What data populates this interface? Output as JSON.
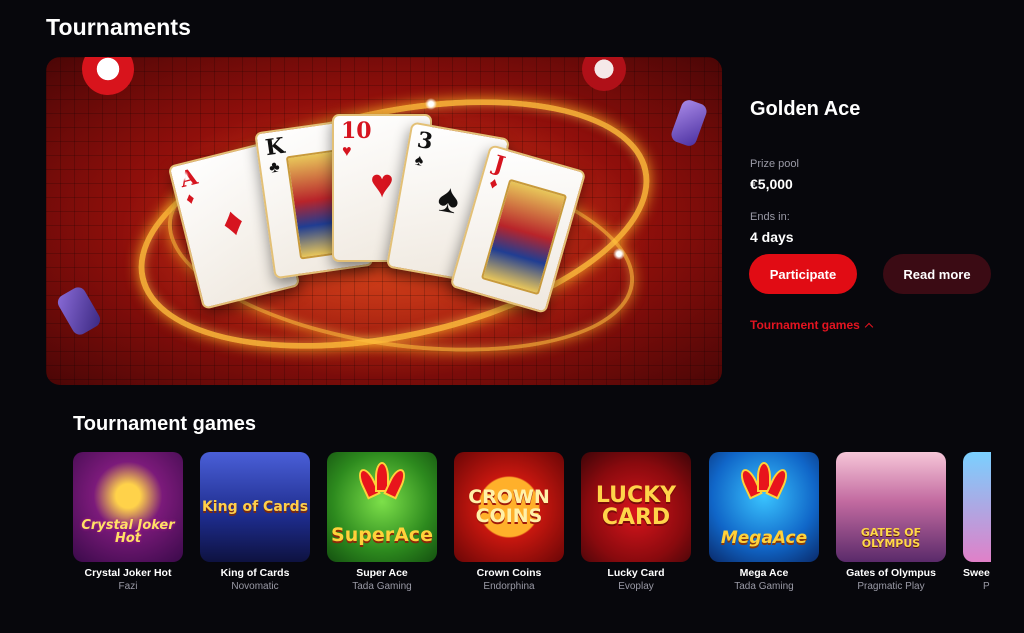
{
  "page": {
    "title": "Tournaments"
  },
  "hero": {
    "cards": [
      {
        "rank": "A",
        "suit": "♦",
        "color": "red"
      },
      {
        "rank": "K",
        "suit": "♣",
        "color": "black"
      },
      {
        "rank": "10",
        "suit": "♥",
        "color": "red"
      },
      {
        "rank": "3",
        "suit": "♠",
        "color": "black"
      },
      {
        "rank": "J",
        "suit": "♦",
        "color": "red"
      }
    ]
  },
  "tournament": {
    "name": "Golden Ace",
    "prize_label": "Prize pool",
    "prize_value": "€5,000",
    "ends_label": "Ends in:",
    "ends_value": "4 days",
    "participate_label": "Participate",
    "read_more_label": "Read more",
    "games_link_label": "Tournament games"
  },
  "colors": {
    "accent": "#e10c14",
    "secondary_button": "#3b0b14",
    "muted_text": "#9a9aa6",
    "background": "#07070c"
  },
  "games_section": {
    "title": "Tournament games",
    "items": [
      {
        "name": "Crystal Joker Hot",
        "provider": "Fazi",
        "logo": "Crystal Joker Hot"
      },
      {
        "name": "King of Cards",
        "provider": "Novomatic",
        "logo": "King of Cards"
      },
      {
        "name": "Super Ace",
        "provider": "Tada Gaming",
        "logo": "SuperAce"
      },
      {
        "name": "Crown Coins",
        "provider": "Endorphina",
        "logo": "CROWN COINS"
      },
      {
        "name": "Lucky Card",
        "provider": "Evoplay",
        "logo": "LUCKY CARD"
      },
      {
        "name": "Mega Ace",
        "provider": "Tada Gaming",
        "logo": "MegaAce"
      },
      {
        "name": "Gates of Olympus",
        "provider": "Pragmatic Play",
        "logo": "GATES OF OLYMPUS"
      },
      {
        "name": "Swee",
        "provider": "P",
        "logo": ""
      }
    ]
  }
}
